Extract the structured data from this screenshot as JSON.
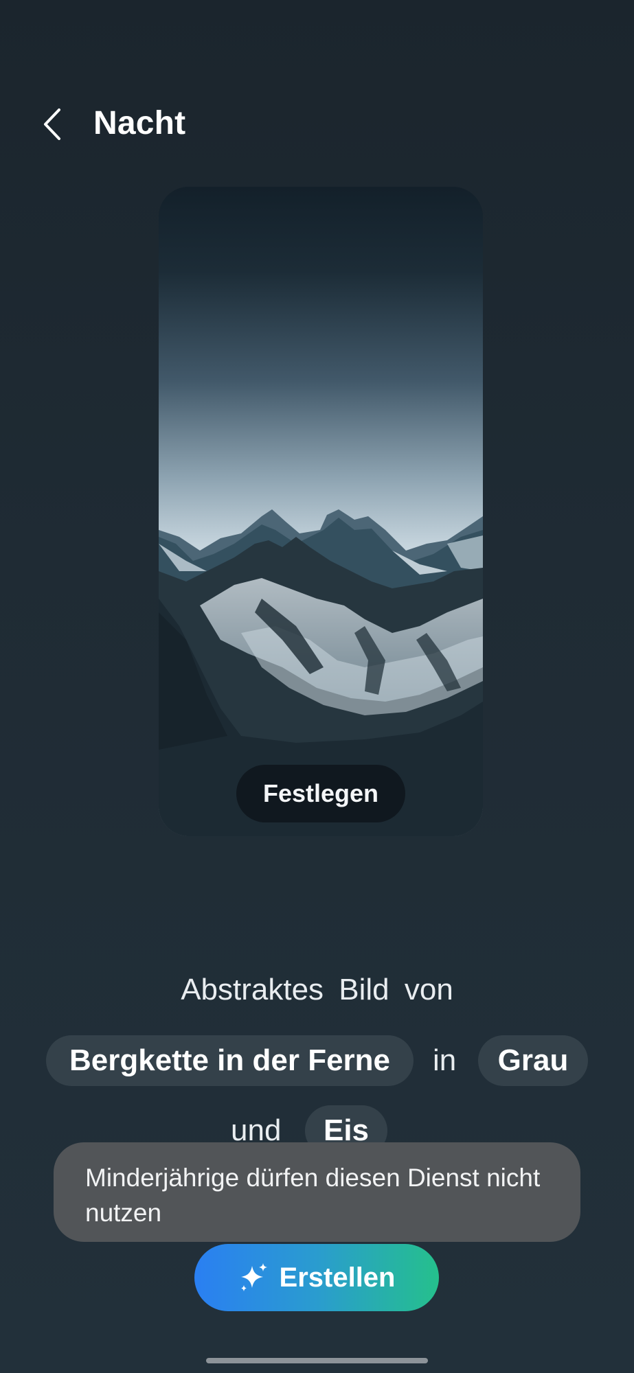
{
  "header": {
    "back_icon": "chevron-left-icon",
    "title": "Nacht"
  },
  "preview": {
    "image": "snowy-mountain-range-wallpaper",
    "set_button_label": "Festlegen"
  },
  "prompt": {
    "intro": "Abstraktes Bild von",
    "subject_chip": "Bergkette in der Ferne",
    "connector_in": "in",
    "color_chip": "Grau",
    "connector_and": "und",
    "style_chip": "Eis"
  },
  "toast": {
    "message": "Minderjährige dürfen diesen Dienst nicht nutzen"
  },
  "create_button": {
    "icon": "sparkles-icon",
    "label": "Erstellen"
  },
  "colors": {
    "background": "#1f2b34",
    "chip": "#34414a",
    "toast": "#525558",
    "gradient_start": "#2a7ff2",
    "gradient_end": "#25c08c"
  }
}
